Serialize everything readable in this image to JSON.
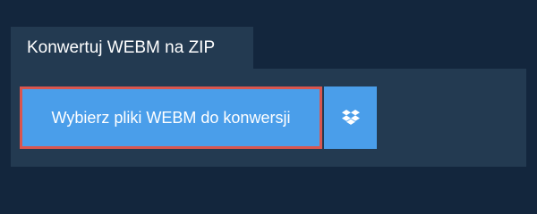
{
  "tab": {
    "label": "Konwertuj WEBM na ZIP"
  },
  "actions": {
    "choose_files_label": "Wybierz pliki WEBM do konwersji",
    "dropbox_icon": "dropbox-icon"
  },
  "colors": {
    "background": "#13263d",
    "panel": "#233a51",
    "button": "#4a9eea",
    "focus_border": "#d9564f",
    "text": "#ffffff"
  }
}
